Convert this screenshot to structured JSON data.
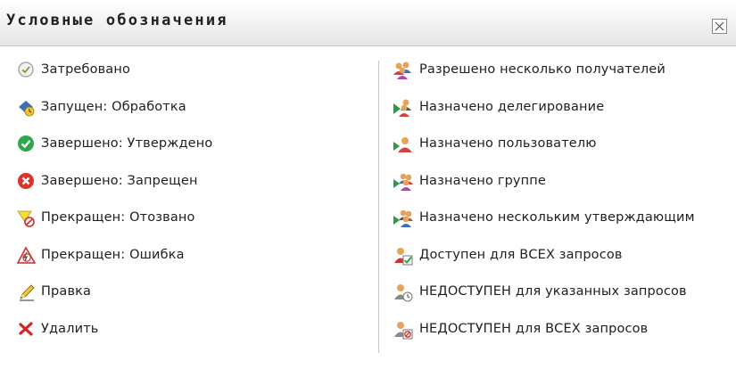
{
  "dialog": {
    "title": "Условные обозначения",
    "close_icon": "close-icon"
  },
  "legend_left": [
    {
      "icon": "requested-icon",
      "label": "Затребовано"
    },
    {
      "icon": "running-processing-icon",
      "label": "Запущен: Обработка"
    },
    {
      "icon": "completed-approved-icon",
      "label": "Завершено: Утверждено"
    },
    {
      "icon": "completed-denied-icon",
      "label": "Завершено: Запрещен"
    },
    {
      "icon": "terminated-retracted-icon",
      "label": "Прекращен: Отозвано"
    },
    {
      "icon": "terminated-error-icon",
      "label": "Прекращен: Ошибка"
    },
    {
      "icon": "edit-icon",
      "label": "Правка"
    },
    {
      "icon": "delete-icon",
      "label": "Удалить"
    }
  ],
  "legend_right": [
    {
      "icon": "multiple-recipients-icon",
      "label": "Разрешено несколько получателей"
    },
    {
      "icon": "delegation-assigned-icon",
      "label": "Назначено делегирование"
    },
    {
      "icon": "user-assigned-icon",
      "label": "Назначено пользователю"
    },
    {
      "icon": "group-assigned-icon",
      "label": "Назначено группе"
    },
    {
      "icon": "multiple-approvers-icon",
      "label": "Назначено нескольким утверждающим"
    },
    {
      "icon": "available-all-requests-icon",
      "label": "Доступен для ВСЕХ запросов"
    },
    {
      "icon": "unavailable-specified-requests-icon",
      "label": "НЕДОСТУПЕН для указанных запросов"
    },
    {
      "icon": "unavailable-all-requests-icon",
      "label": "НЕДОСТУПЕН для ВСЕХ запросов"
    }
  ]
}
